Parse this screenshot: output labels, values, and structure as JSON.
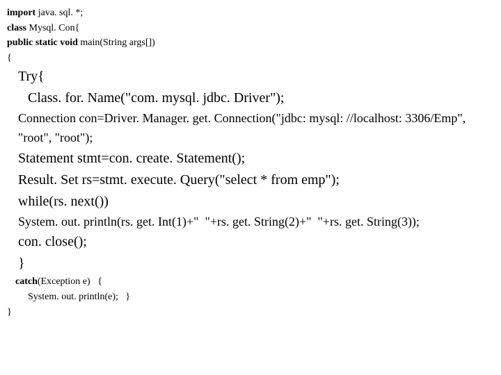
{
  "code": {
    "l1_a": "import",
    "l1_b": " java. sql. *;",
    "l2_a": "class",
    "l2_b": " Mysql. Con{",
    "l3_a": "public static void",
    "l3_b": " main(String args[])",
    "l4": "{",
    "l5": "Try{",
    "l6": "Class. for. Name(\"com. mysql. jdbc. Driver\");",
    "l7": "Connection con=Driver. Manager. get. Connection(\"jdbc: mysql: //localhost: 3306/Emp\",",
    "l8": "\"root\", \"root\");",
    "l9": "Statement stmt=con. create. Statement();",
    "l10": "Result. Set rs=stmt. execute. Query(\"select * from emp\");",
    "l11": "while(rs. next())",
    "l12": "System. out. println(rs. get. Int(1)+\"  \"+rs. get. String(2)+\"  \"+rs. get. String(3));",
    "l13": "con. close();",
    "l14": "}",
    "l15_a": "catch",
    "l15_b": "(Exception e)   {",
    "l16": "System. out. println(e);   }",
    "l17": "}"
  }
}
